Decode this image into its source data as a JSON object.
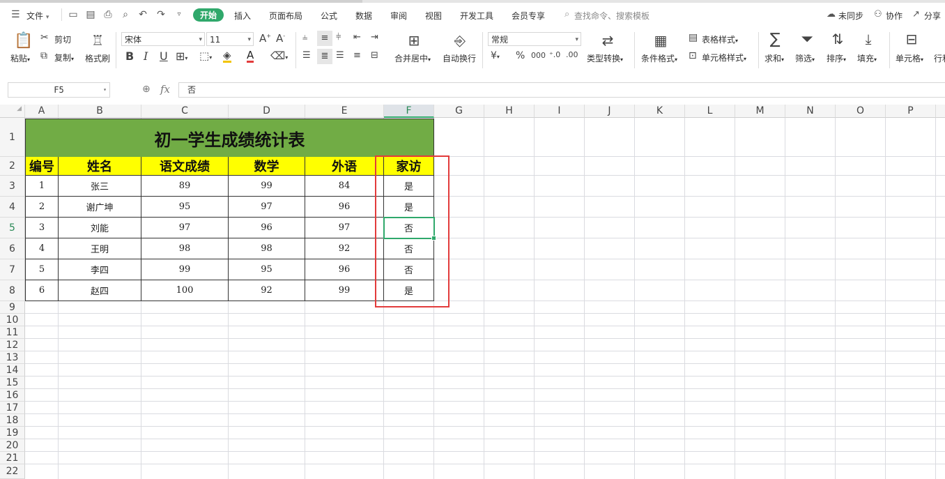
{
  "menubar": {
    "file_label": "文件",
    "tabs": [
      "开始",
      "插入",
      "页面布局",
      "公式",
      "数据",
      "审阅",
      "视图",
      "开发工具",
      "会员专享"
    ],
    "search_placeholder": "查找命令、搜索模板",
    "sync_label": "未同步",
    "collab_label": "协作",
    "share_label": "分享"
  },
  "ribbon": {
    "paste": "粘贴",
    "cut": "剪切",
    "copy": "复制",
    "format_painter": "格式刷",
    "font_name": "宋体",
    "font_size": "11",
    "bold": "B",
    "italic": "I",
    "underline": "U",
    "merge_center": "合并居中",
    "wrap_text": "自动换行",
    "number_format": "常规",
    "currency": "¥",
    "percent": "%",
    "thousands": "000",
    "convert_type": "类型转换",
    "cond_format": "条件格式",
    "table_style": "表格样式",
    "cell_style": "单元格样式",
    "sum": "求和",
    "filter": "筛选",
    "sort": "排序",
    "fill": "填充",
    "cell": "单元格",
    "row_col": "行和"
  },
  "formula_bar": {
    "name_box": "F5",
    "fx": "fx",
    "content": "否"
  },
  "sheet": {
    "columns": [
      "A",
      "B",
      "C",
      "D",
      "E",
      "F",
      "G",
      "H",
      "I",
      "J",
      "K",
      "L",
      "M",
      "N",
      "O",
      "P"
    ],
    "rows": [
      "1",
      "2",
      "3",
      "4",
      "5",
      "6",
      "7",
      "8",
      "9",
      "10",
      "11",
      "12",
      "13",
      "14",
      "15",
      "16",
      "17",
      "18",
      "19",
      "20",
      "21",
      "22"
    ],
    "title": "初一学生成绩统计表",
    "headers": [
      "编号",
      "姓名",
      "语文成绩",
      "数学",
      "外语",
      "家访"
    ],
    "data": [
      [
        "1",
        "张三",
        "89",
        "99",
        "84",
        "是"
      ],
      [
        "2",
        "谢广坤",
        "95",
        "97",
        "96",
        "是"
      ],
      [
        "3",
        "刘能",
        "97",
        "96",
        "97",
        "否"
      ],
      [
        "4",
        "王明",
        "98",
        "98",
        "92",
        "否"
      ],
      [
        "5",
        "李四",
        "99",
        "95",
        "96",
        "否"
      ],
      [
        "6",
        "赵四",
        "100",
        "92",
        "99",
        "是"
      ]
    ],
    "selected_cell": "F5"
  }
}
